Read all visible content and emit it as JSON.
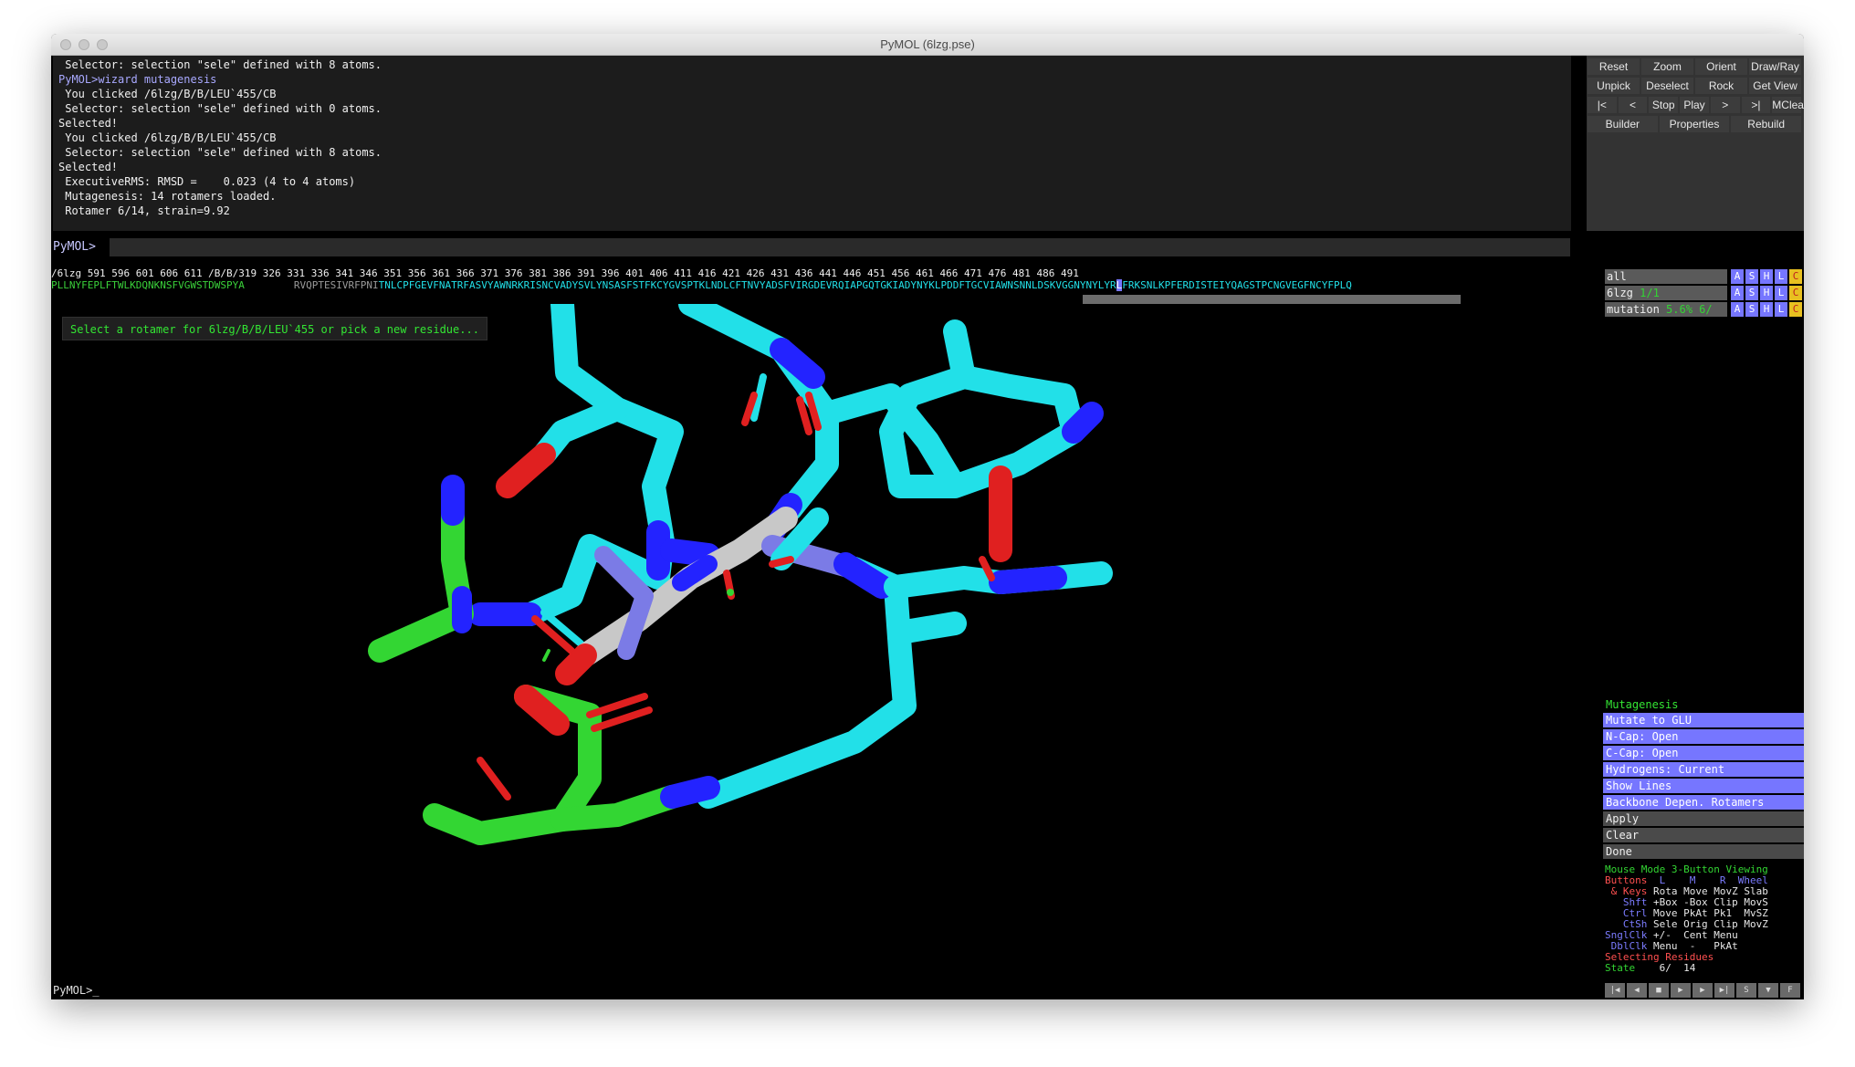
{
  "window": {
    "title": "PyMOL (6lzg.pse)"
  },
  "console": {
    "lines": [
      {
        "text": " Selector: selection \"sele\" defined with 8 atoms.",
        "cmd": false
      },
      {
        "text": "PyMOL>wizard mutagenesis",
        "cmd": true
      },
      {
        "text": " You clicked /6lzg/B/B/LEU`455/CB",
        "cmd": false
      },
      {
        "text": " Selector: selection \"sele\" defined with 0 atoms.",
        "cmd": false
      },
      {
        "text": "Selected!",
        "cmd": false
      },
      {
        "text": " You clicked /6lzg/B/B/LEU`455/CB",
        "cmd": false
      },
      {
        "text": " Selector: selection \"sele\" defined with 8 atoms.",
        "cmd": false
      },
      {
        "text": "Selected!",
        "cmd": false
      },
      {
        "text": " ExecutiveRMS: RMSD =    0.023 (4 to 4 atoms)",
        "cmd": false
      },
      {
        "text": " Mutagenesis: 14 rotamers loaded.",
        "cmd": false
      },
      {
        "text": " Rotamer 6/14, strain=9.92",
        "cmd": false
      }
    ],
    "prompt_label": "PyMOL>"
  },
  "buttons": [
    [
      "Reset",
      "Zoom",
      "Orient",
      "Draw/Ray"
    ],
    [
      "Unpick",
      "Deselect",
      "Rock",
      "Get View"
    ],
    [
      "|<",
      "<",
      "Stop",
      "Play",
      ">",
      ">|",
      "MClear"
    ],
    [
      "Builder",
      "Properties",
      "Rebuild"
    ]
  ],
  "sequence": {
    "numbers": "/6lzg    591   596   601   606   611 /B/B/319     326   331   336   341   346   351   356   361   366   371   376   381   386   391   396   401   406   411   416   421   426   431   436   441   446   451   456   461   466   471   476   481   486   491",
    "residues_green": "PLLNYFEPLFTWLKDQNKNSFVGWSTDWSPYA",
    "residues_grey": "RVQPTESIVRFPNI",
    "residues_cyan_a": "TNLCPFGEVFNATRFASVYAWNRKRISNCVADYSVLYNSASFSTFKCYGVSPTKLNDLCFTNVYADSFVIRGDEVRQIAPGQTGKIADYNYKLPDDFTGCVIAWNSNNLDSKVGGNYNYLYR",
    "residues_selected": "L",
    "residues_cyan_b": "FRKSNLKPFERDISTEIYQAGSTPCNGVEGFNCYFPLQ"
  },
  "viewport": {
    "wizard_message": "Select a rotamer for 6lzg/B/B/LEU`455 or pick a new residue..."
  },
  "objects": [
    {
      "name": "all",
      "extra": ""
    },
    {
      "name": "6lzg",
      "extra": "1/1"
    },
    {
      "name": "mutation",
      "extra": "5.6% 6/"
    }
  ],
  "object_buttons": [
    "A",
    "S",
    "H",
    "L",
    "C"
  ],
  "wizard": {
    "title": "Mutagenesis",
    "actions": [
      "Mutate to GLU",
      "N-Cap: Open",
      "C-Cap: Open",
      "Hydrogens: Current",
      "Show Lines",
      "Backbone Depen. Rotamers"
    ],
    "plain": [
      "Apply",
      "Clear",
      "Done"
    ]
  },
  "mouse": {
    "header": "Mouse Mode 3-Button Viewing",
    "buttons_label": "Buttons",
    "buttons_cols": "  L    M    R  Wheel",
    "rows": [
      {
        "label": " & Keys",
        "vals": "Rota Move MovZ Slab"
      },
      {
        "label": "   Shft",
        "vals": "+Box -Box Clip MovS"
      },
      {
        "label": "   Ctrl",
        "vals": "Move PkAt Pk1  MvSZ"
      },
      {
        "label": "   CtSh",
        "vals": "Sele Orig Clip MovZ"
      },
      {
        "label": "SnglClk",
        "vals": "+/-  Cent Menu"
      },
      {
        "label": " DblClk",
        "vals": "Menu  -   PkAt"
      }
    ],
    "selecting": "Selecting Residues",
    "state_label": "State",
    "state_value": "    6/  14"
  },
  "bottom": {
    "prompt": "PyMOL>_"
  },
  "transport": [
    "|◀",
    "◀",
    "■",
    "▶",
    "▶",
    "▶|",
    "S",
    "▼",
    "F"
  ],
  "colors": {
    "cyan": "#22e0e8",
    "green": "#33d633",
    "blue": "#2323ff",
    "red": "#e02020",
    "grey": "#c8c8c8",
    "slate": "#7b7be6"
  }
}
